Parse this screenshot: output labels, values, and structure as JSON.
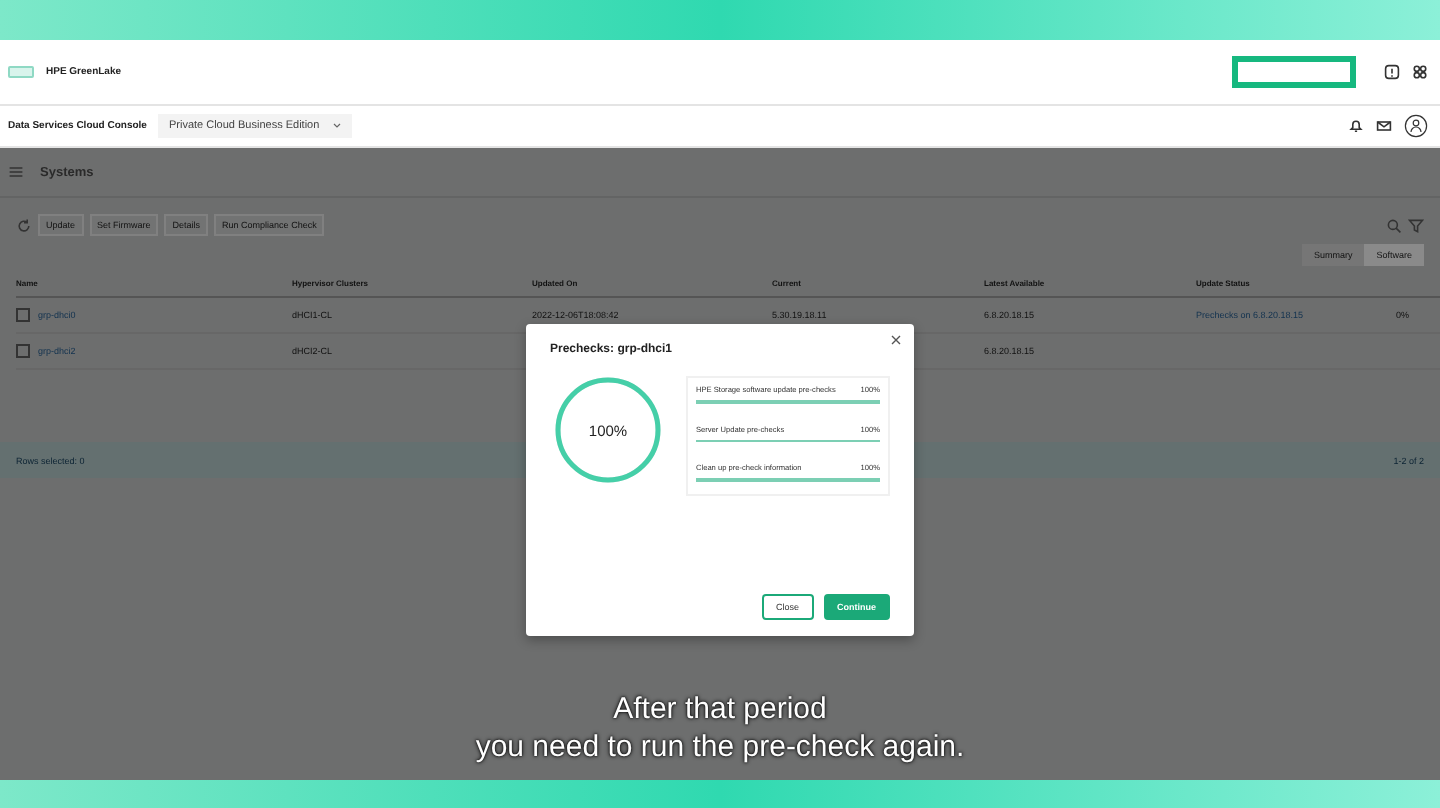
{
  "header": {
    "brand": "HPE GreenLake",
    "console": "Data Services Cloud Console",
    "edition": "Private Cloud Business Edition"
  },
  "page": {
    "title": "Systems",
    "actions": [
      "Update",
      "Set Firmware",
      "Details",
      "Run Compliance Check"
    ],
    "views": [
      {
        "label": "Summary",
        "selected": false
      },
      {
        "label": "Software",
        "selected": true
      }
    ]
  },
  "table": {
    "columns": [
      "Name",
      "Hypervisor Clusters",
      "Updated On",
      "Current",
      "Latest Available",
      "Update Status"
    ],
    "rows": [
      {
        "checked": false,
        "cells": [
          "grp-dhci0",
          "dHCI1-CL",
          "2022-12-06T18:08:42",
          "5.30.19.18.11",
          "6.8.20.18.15",
          "Prechecks on 6.8.20.18.15",
          "0%"
        ]
      },
      {
        "checked": false,
        "cells": [
          "grp-dhci2",
          "dHCI2-CL",
          "",
          "",
          "6.8.20.18.15",
          "",
          ""
        ]
      }
    ],
    "footer": "Rows selected: 0",
    "pagination": "1-2 of 2"
  },
  "dialog": {
    "title": "Prechecks: grp-dhci1",
    "overall": "100%",
    "level": 1,
    "tasks": [
      {
        "label": "HPE Storage software update pre-checks",
        "reading": "100%",
        "level": 1
      },
      {
        "label": "Server Update pre-checks",
        "reading": "100%",
        "level": 1
      },
      {
        "label": "Clean up pre-check information",
        "reading": "100%",
        "level": 1
      }
    ],
    "buttons": [
      {
        "label": "Close",
        "kind": "secondary"
      },
      {
        "label": "Continue",
        "kind": "primary"
      }
    ]
  },
  "caption": [
    "After that period",
    "you need to run the pre-check again."
  ]
}
